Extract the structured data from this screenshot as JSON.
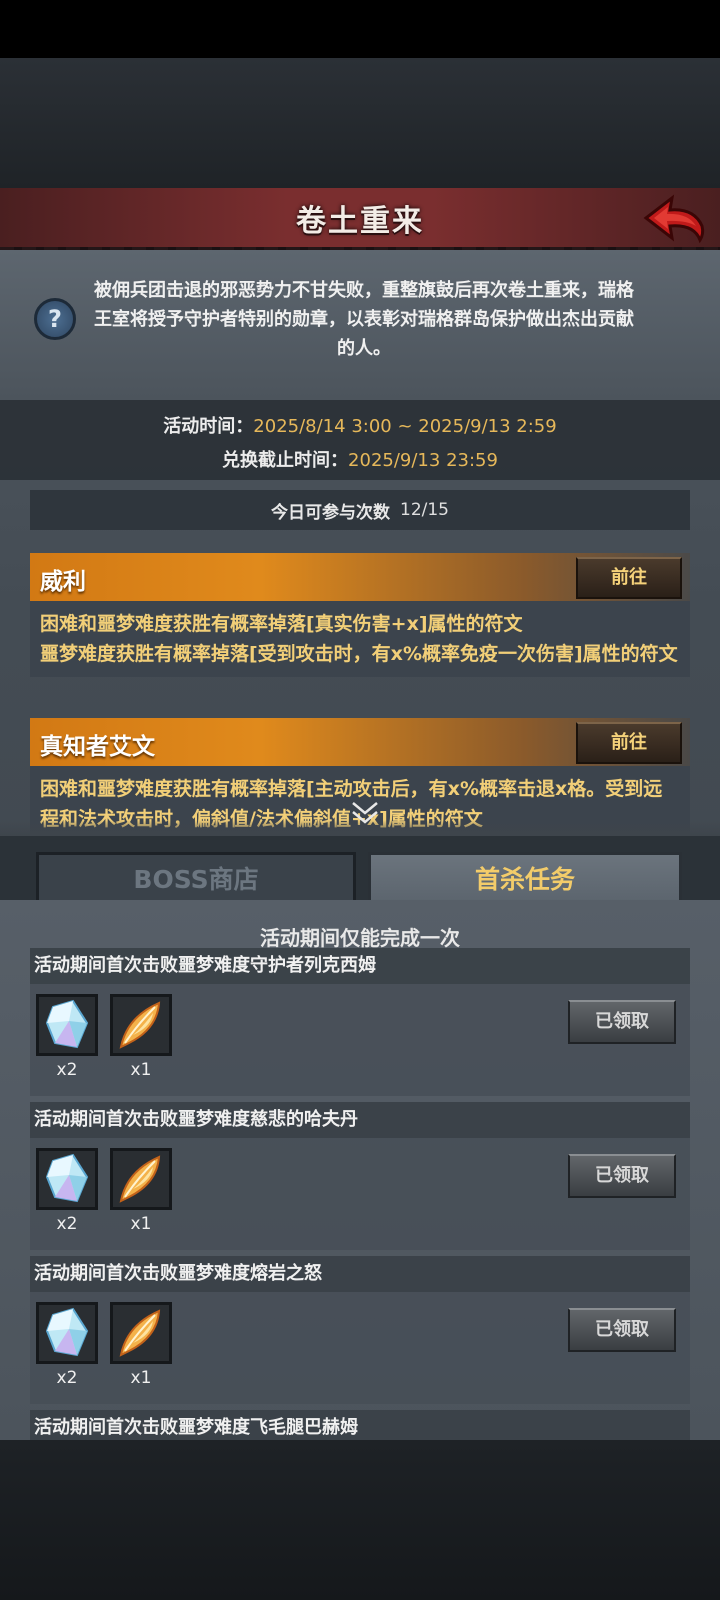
{
  "header": {
    "title": "卷土重来"
  },
  "description": "被佣兵团击退的邪恶势力不甘失败，重整旗鼓后再次卷土重来，瑞格王室将授予守护者特别的勋章，以表彰对瑞格群岛保护做出杰出贡献的人。",
  "event_time": {
    "label": "活动时间：",
    "value": "2025/8/14 3:00 ~ 2025/9/13 2:59",
    "exchange_label": "兑换截止时间：",
    "exchange_value": "2025/9/13 23:59"
  },
  "daily": {
    "label": "今日可参与次数",
    "value": "12/15"
  },
  "bosses": [
    {
      "name": "威利",
      "button": "前往",
      "lines": [
        "困难和噩梦难度获胜有概率掉落[真实伤害+x]属性的符文",
        "噩梦难度获胜有概率掉落[受到攻击时，有x%概率免疫一次伤害]属性的符文"
      ]
    },
    {
      "name": "真知者艾文",
      "button": "前往",
      "lines": [
        "困难和噩梦难度获胜有概率掉落[主动攻击后，有x%概率击退x格。受到远程和法术攻击时，偏斜值/法术偏斜值+x]属性的符文"
      ]
    }
  ],
  "tabs": {
    "shop": "BOSS商店",
    "first_kill": "首杀任务"
  },
  "notice": "活动期间仅能完成一次",
  "tasks": [
    {
      "title": "活动期间首次击败噩梦难度守护者列克西姆",
      "items": [
        {
          "icon": "crystal-icon",
          "qty": "x2"
        },
        {
          "icon": "feather-icon",
          "qty": "x1"
        }
      ],
      "button": "已领取"
    },
    {
      "title": "活动期间首次击败噩梦难度慈悲的哈夫丹",
      "items": [
        {
          "icon": "crystal-icon",
          "qty": "x2"
        },
        {
          "icon": "feather-icon",
          "qty": "x1"
        }
      ],
      "button": "已领取"
    },
    {
      "title": "活动期间首次击败噩梦难度熔岩之怒",
      "items": [
        {
          "icon": "crystal-icon",
          "qty": "x2"
        },
        {
          "icon": "feather-icon",
          "qty": "x1"
        }
      ],
      "button": "已领取"
    },
    {
      "title": "活动期间首次击败噩梦难度飞毛腿巴赫姆"
    }
  ],
  "colors": {
    "accent": "#e6b85a",
    "banner": "#7a2e2f",
    "boss_header": "#e08a1c"
  }
}
